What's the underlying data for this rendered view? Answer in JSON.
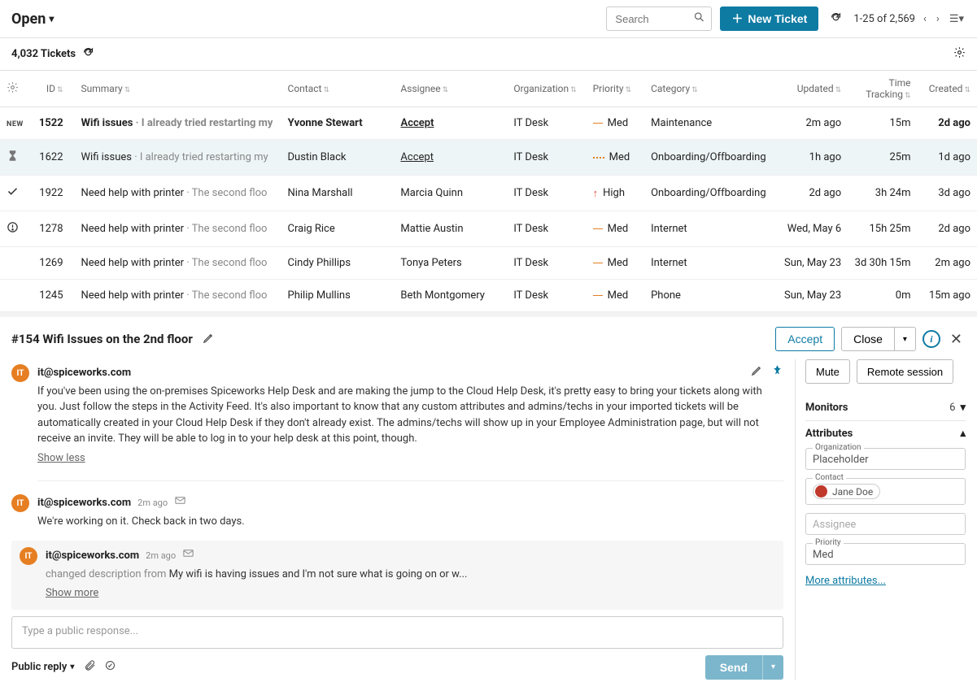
{
  "header": {
    "view_title": "Open",
    "search_placeholder": "Search",
    "new_ticket_label": "New Ticket",
    "pagination_text": "1-25 of 2,569"
  },
  "count_row": {
    "tickets_count": "4,032 Tickets"
  },
  "columns": {
    "id": "ID",
    "summary": "Summary",
    "contact": "Contact",
    "assignee": "Assignee",
    "organization": "Organization",
    "priority": "Priority",
    "category": "Category",
    "updated": "Updated",
    "tracking": "Time Tracking",
    "created": "Created"
  },
  "rows": [
    {
      "status": "NEW",
      "id": "1522",
      "summary_main": "Wifi issues",
      "summary_sec": "I already tried restarting my",
      "contact": "Yvonne Stewart",
      "assignee": "Accept",
      "assignee_type": "link-bold",
      "org": "IT Desk",
      "priority_icon": "dash",
      "priority_label": "Med",
      "category": "Maintenance",
      "updated": "2m ago",
      "tracking": "15m",
      "created": "2d ago",
      "highlight": false,
      "first_new": true
    },
    {
      "status": "hourglass",
      "id": "1622",
      "summary_main": "Wifi issues",
      "summary_sec": "I already tried restarting my",
      "contact": "Dustin Black",
      "assignee": "Accept",
      "assignee_type": "link",
      "org": "IT Desk",
      "priority_icon": "dotted",
      "priority_label": "Med",
      "category": "Onboarding/Offboarding",
      "updated": "1h ago",
      "tracking": "25m",
      "created": "1d ago",
      "highlight": true
    },
    {
      "status": "check",
      "id": "1922",
      "summary_main": "Need help with printer",
      "summary_sec": "The second floo",
      "contact": "Nina Marshall",
      "assignee": "Marcia Quinn",
      "assignee_type": "text",
      "org": "IT Desk",
      "priority_icon": "up",
      "priority_label": "High",
      "category": "Onboarding/Offboarding",
      "updated": "2d ago",
      "tracking": "3h 24m",
      "created": "3d ago"
    },
    {
      "status": "alert",
      "id": "1278",
      "summary_main": "Need help with printer",
      "summary_sec": "The second floo",
      "contact": "Craig Rice",
      "assignee": "Mattie Austin",
      "assignee_type": "text",
      "org": "IT Desk",
      "priority_icon": "dash",
      "priority_label": "Med",
      "category": "Internet",
      "updated": "Wed, May 6",
      "tracking": "15h 25m",
      "created": "2d ago"
    },
    {
      "status": "",
      "id": "1269",
      "summary_main": "Need help with printer",
      "summary_sec": "The second floo",
      "contact": "Cindy Phillips",
      "assignee": "Tonya Peters",
      "assignee_type": "text",
      "org": "IT Desk",
      "priority_icon": "dash",
      "priority_label": "Med",
      "category": "Internet",
      "updated": "Sun, May 23",
      "tracking": "3d 30h 15m",
      "created": "2m ago"
    },
    {
      "status": "",
      "id": "1245",
      "summary_main": "Need help with printer",
      "summary_sec": "The second floo",
      "contact": "Philip Mullins",
      "assignee": "Beth Montgomery",
      "assignee_type": "text",
      "org": "IT Desk",
      "priority_icon": "dash",
      "priority_label": "Med",
      "category": "Phone",
      "updated": "Sun, May 23",
      "tracking": "0m",
      "created": "15m ago"
    }
  ],
  "detail": {
    "title": "#154 Wifi Issues on the 2nd floor",
    "accept_label": "Accept",
    "close_label": "Close",
    "comments": [
      {
        "author": "it@spiceworks.com",
        "time": "",
        "body": "If you've been using the on-premises Spiceworks Help Desk and are making the jump to the Cloud Help Desk, it's pretty easy to bring your tickets along with you. Just follow the steps in the Activity Feed. It's also important to know that any custom attributes and admins/techs in your imported tickets will be automatically created in your Cloud Help Desk if they don't already exist. The admins/techs will show up in your Employee Administration page, but will not receive an invite. They will be able to log in to your help desk at this point, though.",
        "toggle": "Show less",
        "icons": true
      },
      {
        "author": "it@spiceworks.com",
        "time": "2m ago",
        "body": "We're working on it. Check back in two days.",
        "mail": true
      },
      {
        "author": "it@spiceworks.com",
        "time": "2m ago",
        "prefix": "changed description from ",
        "body": "My wifi is having issues and I'm not sure what is going on or w...",
        "toggle": "Show more",
        "boxed": true,
        "mail": true
      }
    ],
    "response_placeholder": "Type a public response...",
    "reply_type": "Public reply",
    "send_label": "Send",
    "side": {
      "mute": "Mute",
      "remote": "Remote session",
      "monitors_label": "Monitors",
      "monitors_count": "6",
      "attributes_label": "Attributes",
      "org_label": "Organization",
      "org_value": "Placeholder",
      "contact_label": "Contact",
      "contact_value": "Jane Doe",
      "assignee_label": "Assignee",
      "assignee_value": "Assignee",
      "priority_label": "Priority",
      "priority_value": "Med",
      "more": "More attributes..."
    }
  }
}
